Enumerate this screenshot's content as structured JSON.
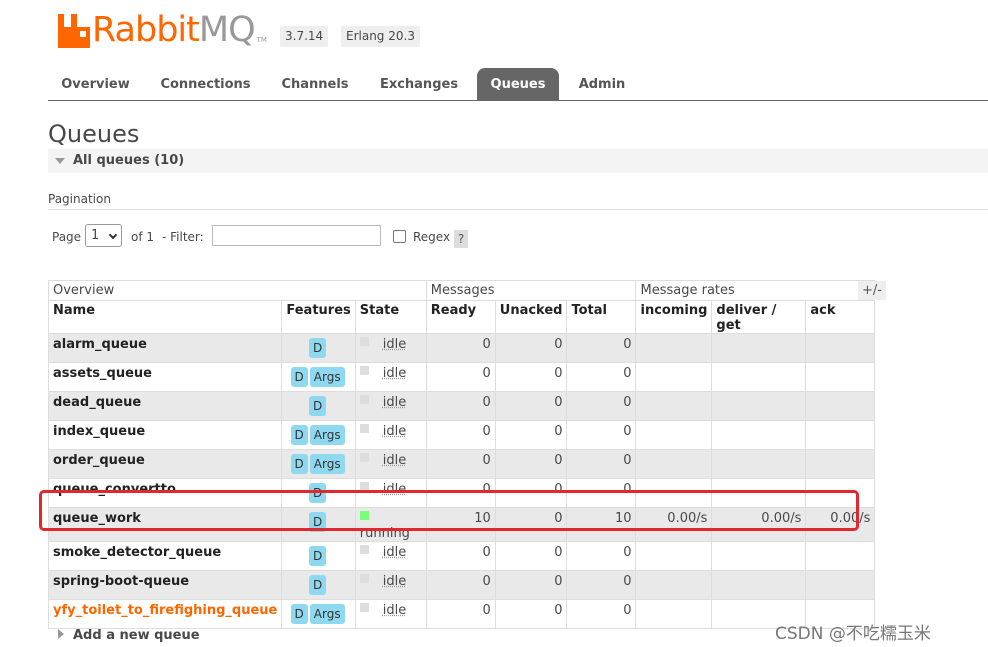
{
  "header": {
    "logo_rabbit": "Rabbit",
    "logo_mq": "MQ",
    "logo_tm": "TM",
    "version": "3.7.14",
    "erlang": "Erlang 20.3"
  },
  "tabs": [
    {
      "label": "Overview"
    },
    {
      "label": "Connections"
    },
    {
      "label": "Channels"
    },
    {
      "label": "Exchanges"
    },
    {
      "label": "Queues",
      "active": true
    },
    {
      "label": "Admin"
    }
  ],
  "page_title": "Queues",
  "section_label": "All queues (10)",
  "pagination": {
    "label": "Pagination",
    "page_text": "Page",
    "page_value": "1",
    "of_text": "of 1",
    "filter_text": "- Filter:",
    "filter_value": "",
    "regex_text": "Regex",
    "help_text": "?"
  },
  "table": {
    "groups": [
      "Overview",
      "Messages",
      "Message rates"
    ],
    "plus_minus": "+/-",
    "columns": [
      "Name",
      "Features",
      "State",
      "Ready",
      "Unacked",
      "Total",
      "incoming",
      "deliver / get",
      "ack"
    ],
    "rows": [
      {
        "name": "alarm_queue",
        "features": [
          "D"
        ],
        "state": "idle",
        "ready": "0",
        "unacked": "0",
        "total": "0",
        "incoming": "",
        "deliver": "",
        "ack": ""
      },
      {
        "name": "assets_queue",
        "features": [
          "D",
          "Args"
        ],
        "state": "idle",
        "ready": "0",
        "unacked": "0",
        "total": "0",
        "incoming": "",
        "deliver": "",
        "ack": ""
      },
      {
        "name": "dead_queue",
        "features": [
          "D"
        ],
        "state": "idle",
        "ready": "0",
        "unacked": "0",
        "total": "0",
        "incoming": "",
        "deliver": "",
        "ack": ""
      },
      {
        "name": "index_queue",
        "features": [
          "D",
          "Args"
        ],
        "state": "idle",
        "ready": "0",
        "unacked": "0",
        "total": "0",
        "incoming": "",
        "deliver": "",
        "ack": ""
      },
      {
        "name": "order_queue",
        "features": [
          "D",
          "Args"
        ],
        "state": "idle",
        "ready": "0",
        "unacked": "0",
        "total": "0",
        "incoming": "",
        "deliver": "",
        "ack": ""
      },
      {
        "name": "queue_convertto",
        "features": [
          "D"
        ],
        "state": "idle",
        "ready": "0",
        "unacked": "0",
        "total": "0",
        "incoming": "",
        "deliver": "",
        "ack": ""
      },
      {
        "name": "queue_work",
        "features": [
          "D"
        ],
        "state": "running",
        "ready": "10",
        "unacked": "0",
        "total": "10",
        "incoming": "0.00/s",
        "deliver": "0.00/s",
        "ack": "0.00/s"
      },
      {
        "name": "smoke_detector_queue",
        "features": [
          "D"
        ],
        "state": "idle",
        "ready": "0",
        "unacked": "0",
        "total": "0",
        "incoming": "",
        "deliver": "",
        "ack": ""
      },
      {
        "name": "spring-boot-queue",
        "features": [
          "D"
        ],
        "state": "idle",
        "ready": "0",
        "unacked": "0",
        "total": "0",
        "incoming": "",
        "deliver": "",
        "ack": ""
      },
      {
        "name": "yfy_toilet_to_firefighing_queue",
        "features": [
          "D",
          "Args"
        ],
        "state": "idle",
        "ready": "0",
        "unacked": "0",
        "total": "0",
        "incoming": "",
        "deliver": "",
        "ack": "",
        "warn": true
      }
    ]
  },
  "add_queue": "Add a new queue",
  "watermark": "CSDN @不吃糯玉米",
  "colors": {
    "brand": "#ff6600",
    "tab_active": "#666666",
    "badge": "#8ed8f0",
    "running": "#77ff77",
    "highlight": "#e0292e"
  }
}
